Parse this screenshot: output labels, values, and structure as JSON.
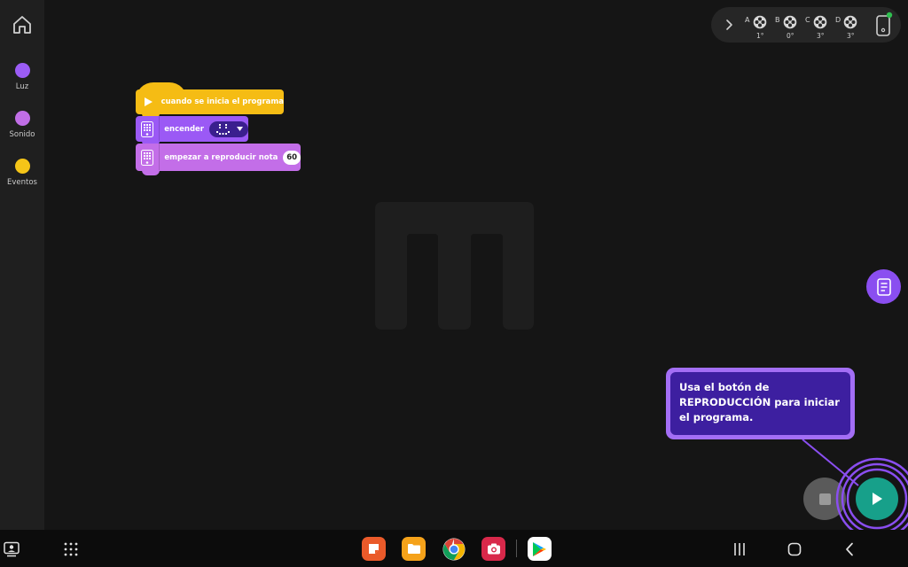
{
  "sidebar": {
    "categories": [
      {
        "label": "Luz",
        "color": "#9b5cf5"
      },
      {
        "label": "Sonido",
        "color": "#c06ee6"
      },
      {
        "label": "Eventos",
        "color": "#f5c518"
      }
    ]
  },
  "blocks": {
    "hat_label": "cuando se inicia el programa",
    "light_label": "encender",
    "sound_label": "empezar a reproducir nota",
    "note_value": "60"
  },
  "hub": {
    "ports": [
      {
        "name": "A",
        "value": "1°"
      },
      {
        "name": "B",
        "value": "0°"
      },
      {
        "name": "C",
        "value": "3°"
      },
      {
        "name": "D",
        "value": "3°"
      }
    ]
  },
  "tooltip": {
    "text": "Usa el botón de REPRODUCCIÓN para iniciar el programa."
  },
  "taskbar": {
    "apps": [
      "notes-app-icon",
      "files-app-icon",
      "chrome-app-icon",
      "camera-app-icon",
      "play-store-icon"
    ]
  },
  "colors": {
    "accent": "#8a4ef0",
    "play": "#17a08a",
    "events": "#f5bc14"
  }
}
